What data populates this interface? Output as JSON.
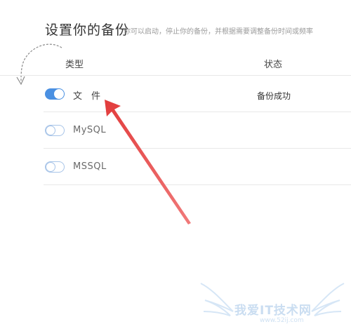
{
  "header": {
    "title": "设置你的备份",
    "subtitle": "你可以启动，停止你的备份，并根据需要调整备份时间或频率"
  },
  "table": {
    "columns": [
      "类型",
      "状态"
    ],
    "rows": [
      {
        "label": "文　件",
        "enabled": true,
        "status": "备份成功"
      },
      {
        "label": "MySQL",
        "enabled": false,
        "status": ""
      },
      {
        "label": "MSSQL",
        "enabled": false,
        "status": ""
      }
    ]
  },
  "annotation": {
    "arrow_color": "#e03c3c",
    "curved_arrow_color": "#888888"
  },
  "watermark": {
    "text": "我爱IT技术网",
    "url": "www.52ij.com"
  },
  "colors": {
    "toggle_on": "#4a90e2",
    "toggle_off_border": "#a7c4e8",
    "divider": "#e8e8e8"
  }
}
